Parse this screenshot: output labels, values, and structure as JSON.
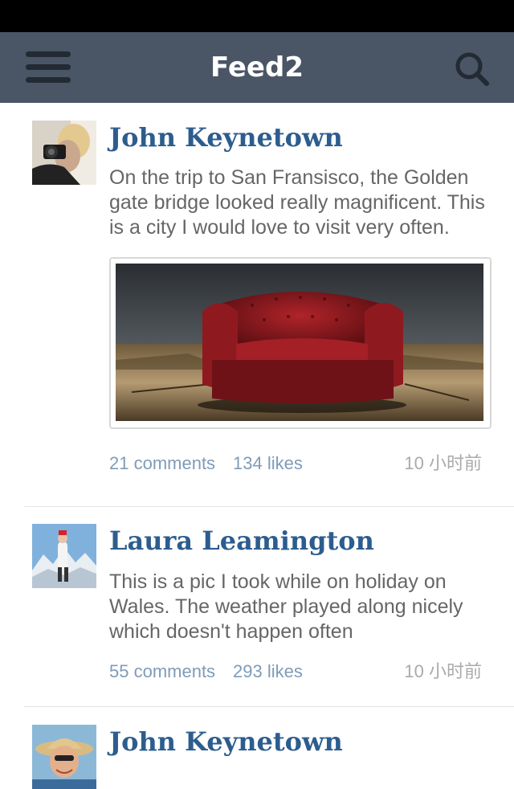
{
  "nav": {
    "title": "Feed2",
    "menu_icon": "hamburger-menu-icon",
    "search_icon": "search-icon"
  },
  "posts": [
    {
      "author": "John Keynetown",
      "text": "On the trip to San Fransisco, the Golden gate bridge looked really magnificent. This is a city I would love to visit very often.",
      "has_image": true,
      "comments": "21 comments",
      "likes": "134 likes",
      "time": "10 小时前"
    },
    {
      "author": "Laura Leamington",
      "text": "This is a pic I took while on holiday on Wales. The weather played along nicely which doesn't happen often",
      "comments": "55 comments",
      "likes": "293 likes",
      "time": "10 小时前"
    },
    {
      "author": "John Keynetown"
    }
  ],
  "colors": {
    "navbar": "#4a5565",
    "author": "#2c5d8e",
    "meta_link": "#7e9cb8",
    "time": "#aaaaaa"
  }
}
